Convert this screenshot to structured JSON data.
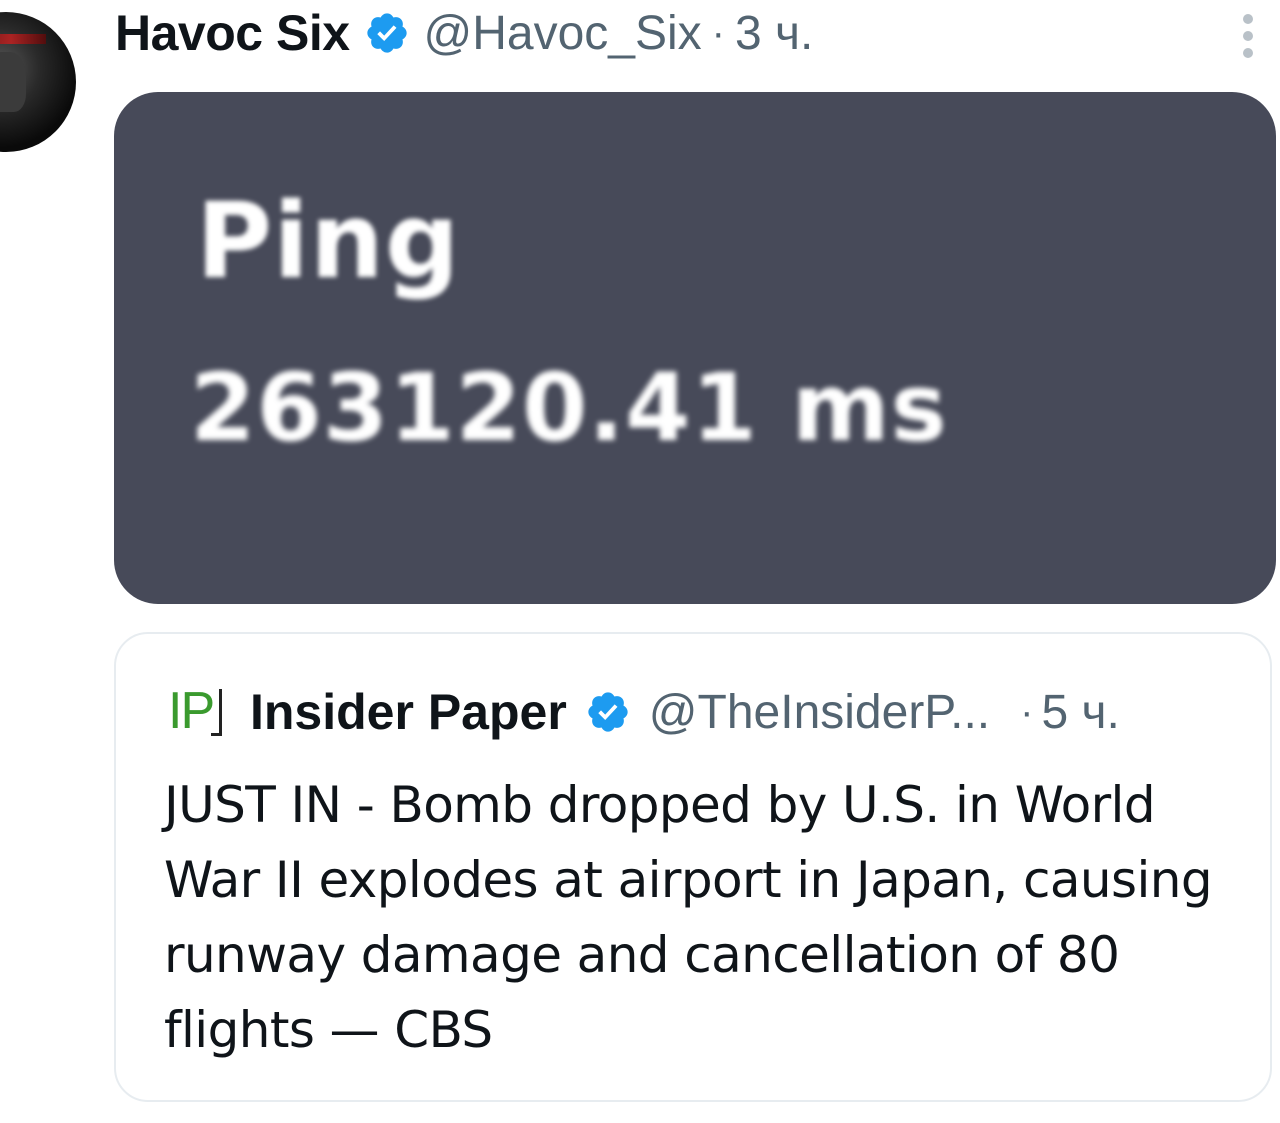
{
  "tweet": {
    "author": "Havoc Six",
    "handle": "@Havoc_Six",
    "separator": "·",
    "time": "3 ч.",
    "media": {
      "label": "Ping",
      "value": "263120.41 ms"
    }
  },
  "quote": {
    "logo_text": "IP",
    "author": "Insider Paper",
    "handle": "@TheInsiderP...",
    "separator": "·",
    "time": "5 ч.",
    "text": "JUST IN - Bomb dropped by U.S. in World War II explodes at airport in Japan, causing runway damage and cancellation of 80 flights — CBS"
  },
  "colors": {
    "verified": "#1d9bf0",
    "media_bg": "#474a59",
    "muted_text": "#536471"
  },
  "icons": {
    "verified": "verified-badge-icon",
    "more": "more-options-icon",
    "logo": "insider-paper-logo-icon"
  }
}
